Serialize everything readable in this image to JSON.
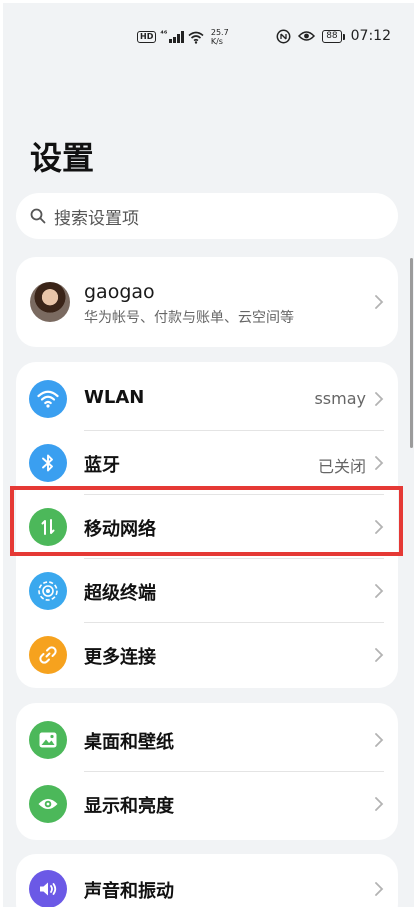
{
  "status_bar": {
    "hd": "HD",
    "signal": "⁴⁶",
    "speed_value": "25.7",
    "speed_unit": "K/s",
    "battery": "88",
    "time": "07:12"
  },
  "header": {
    "title": "设置"
  },
  "search": {
    "placeholder": "搜索设置项"
  },
  "profile": {
    "name": "gaogao",
    "subtitle": "华为帐号、付款与账单、云空间等"
  },
  "group1": {
    "items": [
      {
        "label": "WLAN",
        "value": "ssmay",
        "icon": "wifi-icon",
        "color": "#3a9ff0"
      },
      {
        "label": "蓝牙",
        "value": "已关闭",
        "icon": "bluetooth-icon",
        "color": "#3a9ff0"
      },
      {
        "label": "移动网络",
        "value": "",
        "icon": "mobile-data-icon",
        "color": "#4cb85a"
      },
      {
        "label": "超级终端",
        "value": "",
        "icon": "super-device-icon",
        "color": "#3aa8ee"
      },
      {
        "label": "更多连接",
        "value": "",
        "icon": "link-icon",
        "color": "#f6a21e"
      }
    ]
  },
  "group2": {
    "items": [
      {
        "label": "桌面和壁纸",
        "icon": "wallpaper-icon",
        "color": "#4cb85a"
      },
      {
        "label": "显示和亮度",
        "icon": "eye-icon",
        "color": "#4cb85a"
      }
    ]
  },
  "group3": {
    "items": [
      {
        "label": "声音和振动",
        "icon": "sound-icon",
        "color": "#6b59e6"
      }
    ]
  }
}
